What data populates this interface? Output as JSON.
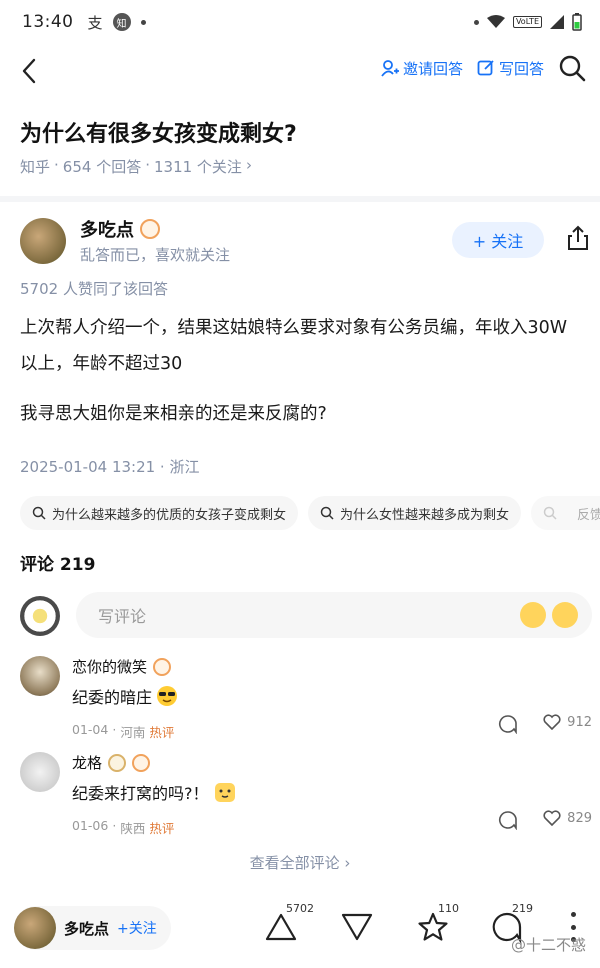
{
  "status_bar": {
    "time": "13:40",
    "network_label": "VoLTE"
  },
  "nav": {
    "invite_label": "邀请回答",
    "write_label": "写回答"
  },
  "question": {
    "title": "为什么有很多女孩变成剩女?",
    "source": "知乎",
    "answers": "654 个回答",
    "followers": "1311 个关注",
    "chevron": "›"
  },
  "answer": {
    "author": "多吃点",
    "bio": "乱答而已，喜欢就关注",
    "follow_label": "+ 关注",
    "upvote_text": "5702 人赞同了该回答",
    "paragraphs": [
      "上次帮人介绍一个，结果这姑娘特么要求对象有公务员编，年收入30W以上，年龄不超过30",
      "我寻思大姐你是来相亲的还是来反腐的?"
    ],
    "posted": "2025-01-04 13:21 · 浙江"
  },
  "related": [
    "为什么越来越多的优质的女孩子变成剩女",
    "为什么女性越来越多成为剩女",
    "反馈"
  ],
  "comments": {
    "title": "评论 219",
    "input_placeholder": "写评论",
    "items": [
      {
        "name": "恋你的微笑",
        "text": "纪委的暗庄",
        "date": "01-04",
        "location": "河南",
        "tag": "热评",
        "likes": "912"
      },
      {
        "name": "龙格",
        "text": "纪委来打窝的吗?！",
        "date": "01-06",
        "location": "陕西",
        "tag": "热评",
        "likes": "829"
      }
    ],
    "see_all": "查看全部评论 ›"
  },
  "bottom_bar": {
    "author": "多吃点",
    "follow_label": "+关注",
    "upvotes": "5702",
    "favorites": "110",
    "comments": "219",
    "watermark": "@十二不惑"
  },
  "colors": {
    "accent": "#1772f6",
    "meta": "#8590a6",
    "hot": "#e07b39"
  }
}
